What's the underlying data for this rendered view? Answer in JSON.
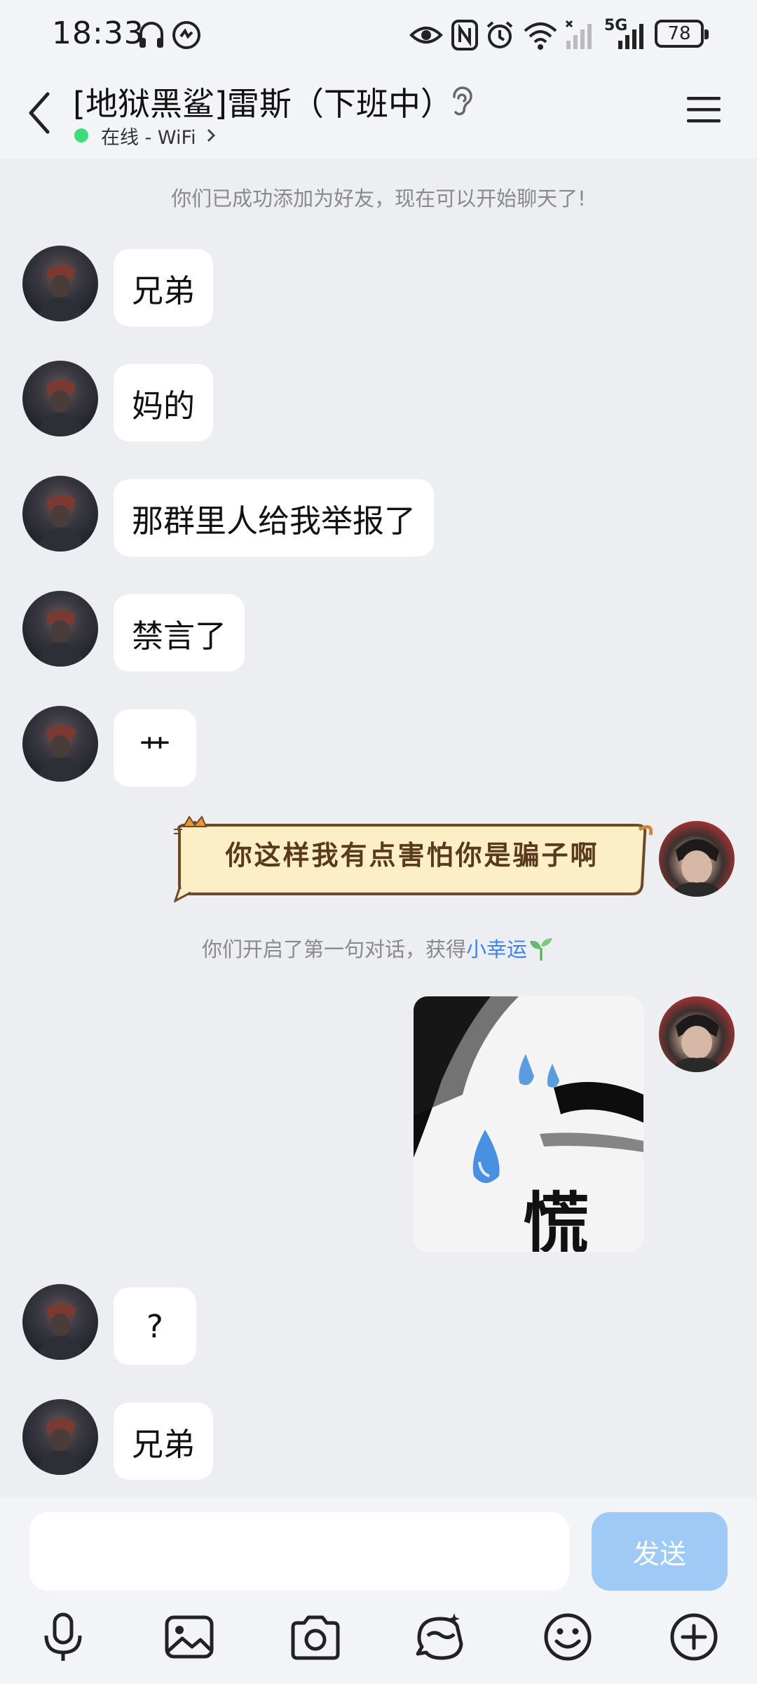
{
  "status_bar": {
    "time": "18:33",
    "battery": "78",
    "network": "5G",
    "icons": [
      "headphones-icon",
      "app-badge-icon",
      "eye-icon",
      "nfc-icon",
      "alarm-icon",
      "wifi-icon",
      "signal-icon",
      "battery-icon"
    ]
  },
  "header": {
    "title": "[地狱黑鲨]雷斯（下班中）",
    "status": "在线 - WiFi",
    "status_color": "#3DDB7A"
  },
  "chat": {
    "system_notice_added": "你们已成功添加为好友，现在可以开始聊天了!",
    "system_notice_first_talk": "你们开启了第一句对话，获得",
    "system_notice_link": "小幸运",
    "messages": [
      {
        "sender": "friend",
        "text": "兄弟"
      },
      {
        "sender": "friend",
        "text": "妈的"
      },
      {
        "sender": "friend",
        "text": "那群里人给我举报了"
      },
      {
        "sender": "friend",
        "text": "禁言了"
      },
      {
        "sender": "friend",
        "text": "艹"
      },
      {
        "sender": "me",
        "type": "sticker-text",
        "text": "你这样我有点害怕你是骗子啊"
      },
      {
        "sender": "me",
        "type": "image",
        "caption": "慌"
      },
      {
        "sender": "friend",
        "text": "?"
      },
      {
        "sender": "friend",
        "text": "兄弟"
      }
    ]
  },
  "input": {
    "placeholder": "",
    "send_label": "发送",
    "send_color": "#9ECAF5"
  },
  "toolbar": [
    "microphone-icon",
    "image-icon",
    "camera-icon",
    "sticker-face-icon",
    "emoji-icon",
    "plus-icon"
  ],
  "colors": {
    "background": "#EDEEF2",
    "bubble": "#FFFFFF",
    "link": "#3B82F6"
  }
}
